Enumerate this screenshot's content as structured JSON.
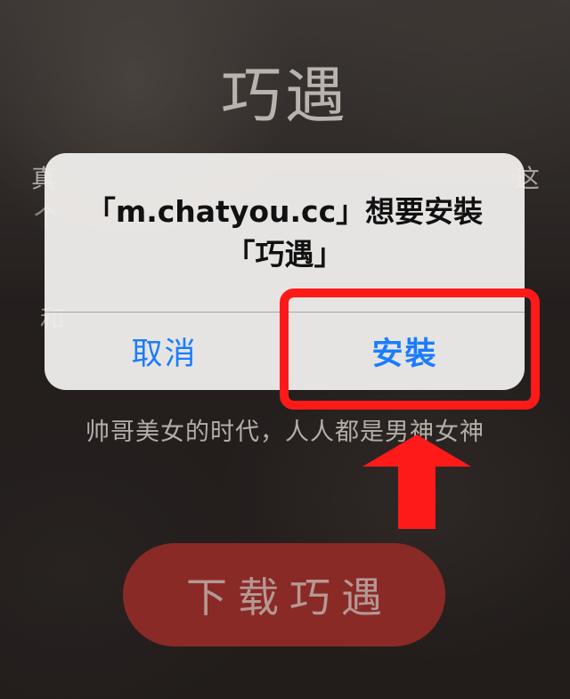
{
  "background": {
    "app_title": "巧遇",
    "text_left_1": "真",
    "text_left_2": "个",
    "text_left_3": "和",
    "text_right_1": "这",
    "tagline": "帅哥美女的时代，人人都是男神女神",
    "download_button": "下载巧遇"
  },
  "alert": {
    "title_line1": "「m.chatyou.cc」想要安裝",
    "title_line2": "「巧遇」",
    "cancel_label": "取消",
    "install_label": "安裝"
  },
  "colors": {
    "alert_button_text": "#1a7cff",
    "highlight": "#ff1a1a",
    "download_button_bg": "#8a2a26"
  }
}
